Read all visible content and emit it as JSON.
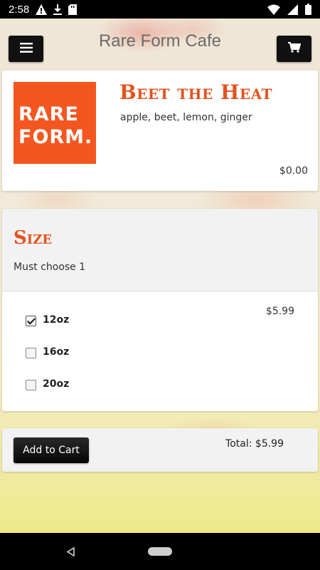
{
  "status_bar": {
    "time": "2:58"
  },
  "header": {
    "title": "Rare Form Cafe"
  },
  "product": {
    "logo_text": [
      "RARE",
      "FORM."
    ],
    "name": "Beet the Heat",
    "description": "apple, beet, lemon, ginger",
    "price": "$0.00"
  },
  "size": {
    "title": "Size",
    "note": "Must choose 1",
    "price": "$5.99",
    "options": [
      {
        "label": "12oz",
        "checked": true
      },
      {
        "label": "16oz",
        "checked": false
      },
      {
        "label": "20oz",
        "checked": false
      }
    ]
  },
  "cart": {
    "add_label": "Add to Cart",
    "total": "Total: $5.99"
  },
  "colors": {
    "accent": "#e4521f",
    "logo_bg": "#f4561f"
  }
}
